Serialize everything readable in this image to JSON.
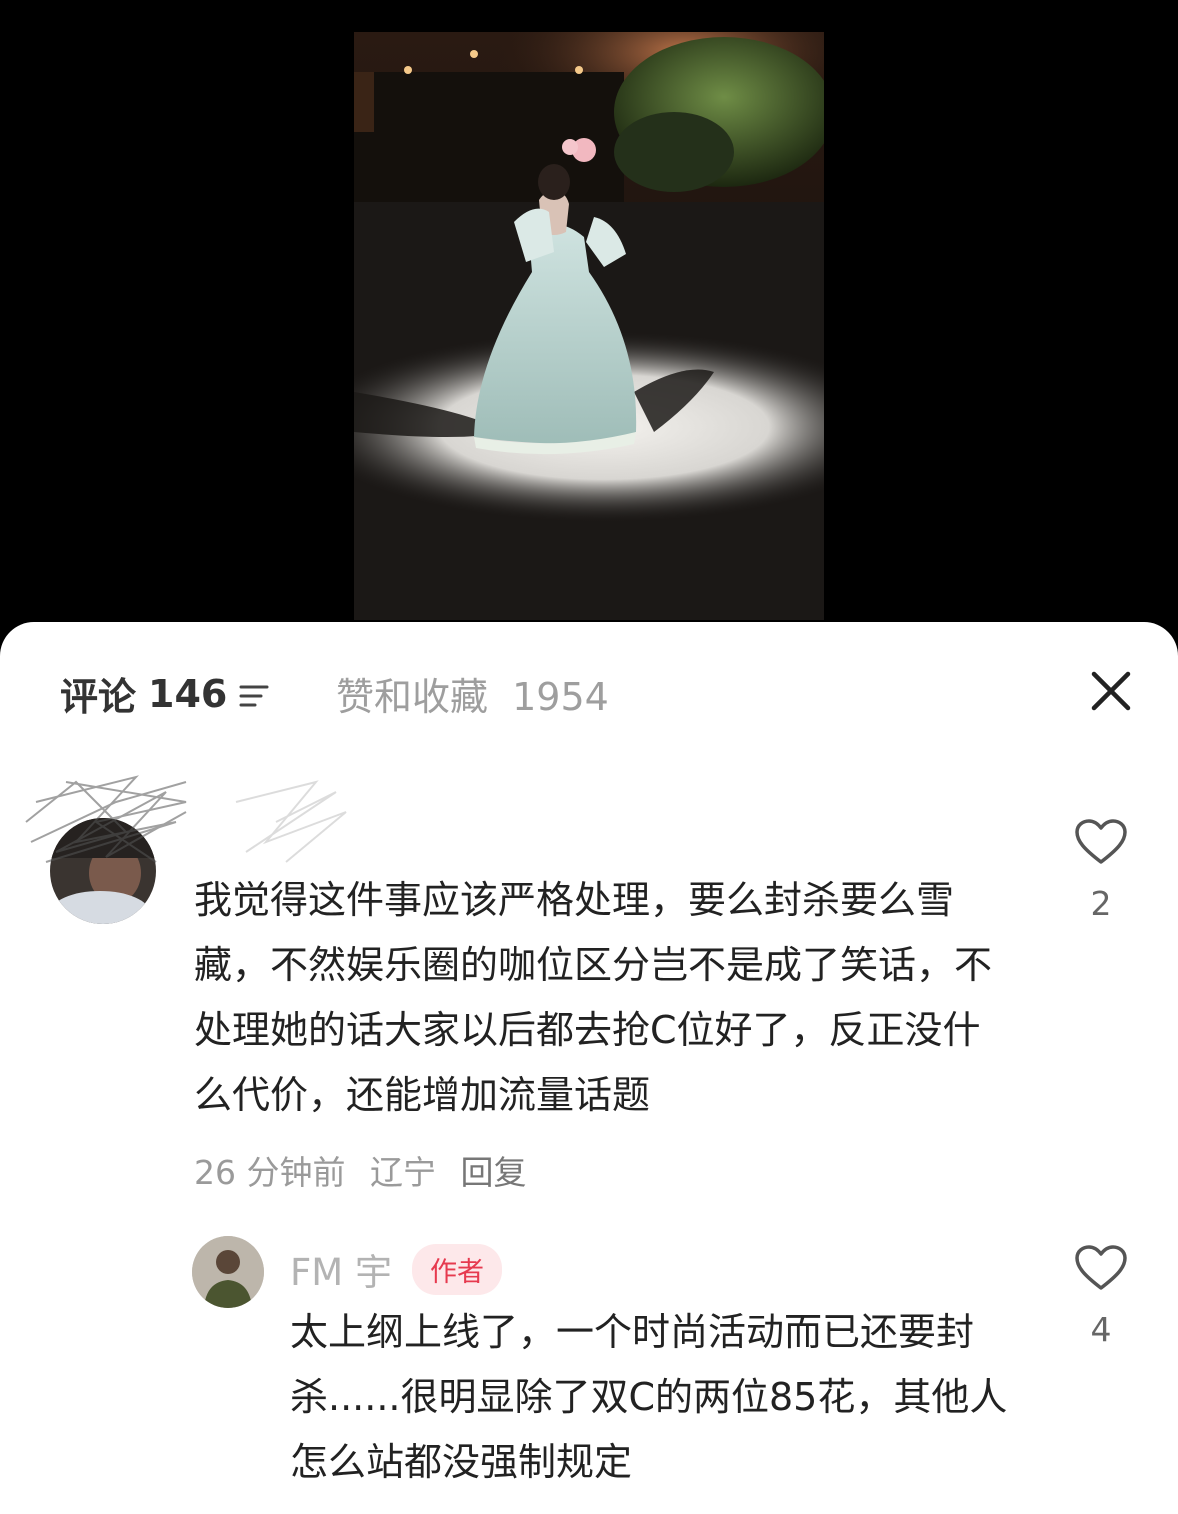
{
  "tabs": {
    "comments_label": "评论",
    "comments_count": "146",
    "likes_label": "赞和收藏",
    "likes_count": "1954"
  },
  "comments": [
    {
      "text": "我觉得这件事应该严格处理，要么封杀要么雪藏，不然娱乐圈的咖位区分岂不是成了笑话，不处理她的话大家以后都去抢C位好了，反正没什么代价，还能增加流量话题",
      "time": "26 分钟前",
      "location": "辽宁",
      "reply_label": "回复",
      "likes": "2"
    }
  ],
  "reply": {
    "username": "FM 宇",
    "badge": "作者",
    "text": "太上纲上线了，一个时尚活动而已还要封杀......很明显除了双C的两位85花，其他人怎么站都没强制规定",
    "likes": "4"
  },
  "colors": {
    "badge_bg": "#fde8ea",
    "badge_text": "#e63a4f",
    "muted_text": "#9a9a9a"
  },
  "icons": [
    "sort-icon",
    "close-icon",
    "heart-icon"
  ]
}
